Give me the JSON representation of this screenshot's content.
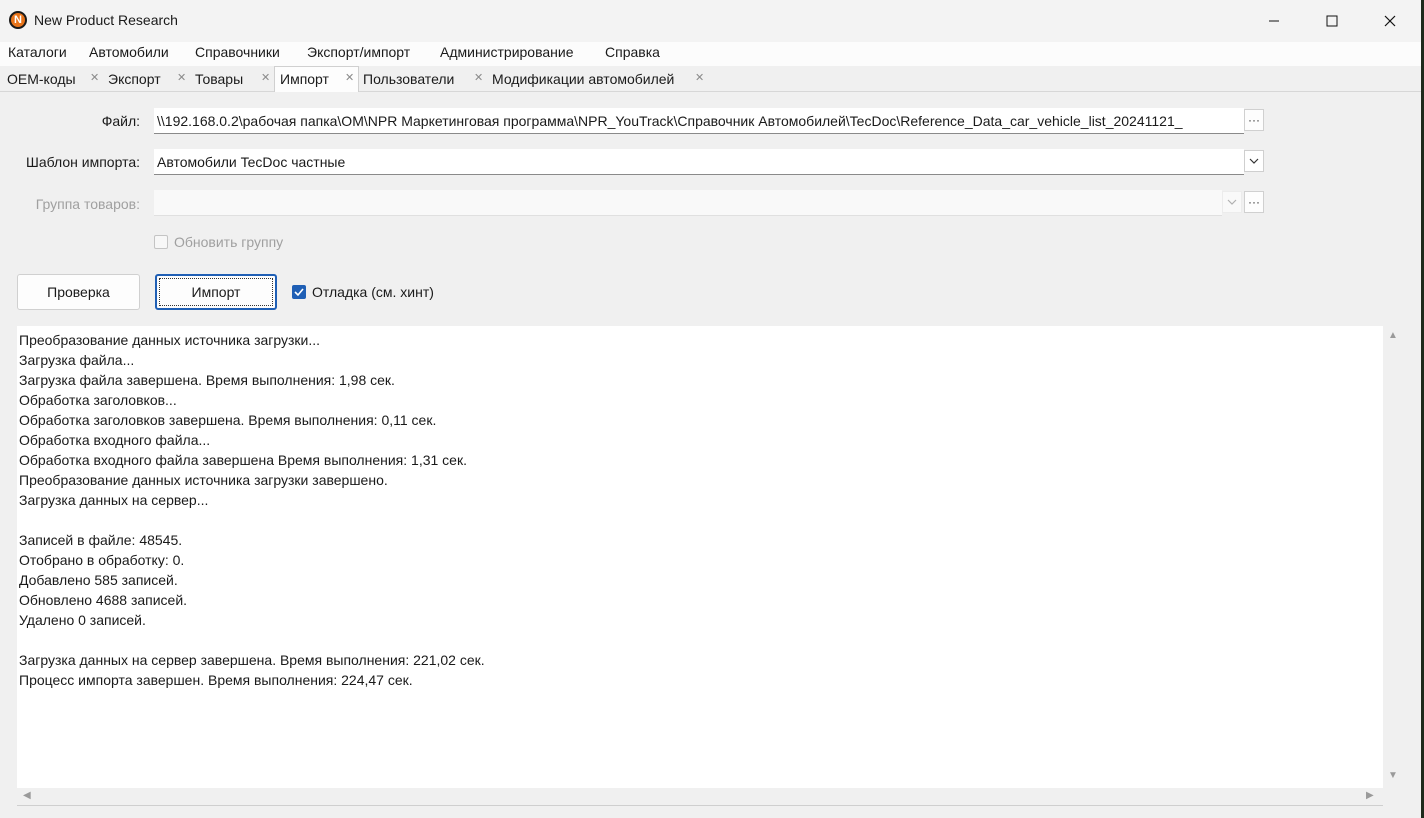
{
  "window": {
    "title": "New Product Research",
    "icon_letter": "N"
  },
  "menu": [
    "Каталоги",
    "Автомобили",
    "Справочники",
    "Экспорт/импорт",
    "Администрирование",
    "Справка"
  ],
  "tabs": [
    {
      "label": "OEM-коды",
      "close": "✕"
    },
    {
      "label": "Экспорт",
      "close": "✕"
    },
    {
      "label": "Товары",
      "close": "✕"
    },
    {
      "label": "Импорт",
      "close": "✕",
      "active": true
    },
    {
      "label": "Пользователи",
      "close": "✕"
    },
    {
      "label": "Модификации автомобилей",
      "close": "✕"
    }
  ],
  "form": {
    "file_label": "Файл:",
    "file_value": "\\\\192.168.0.2\\рабочая папка\\OM\\NPR Маркетинговая программа\\NPR_YouTrack\\Справочник Автомобилей\\TecDoc\\Reference_Data_car_vehicle_list_20241121_",
    "browse": "···",
    "template_label": "Шаблон импорта:",
    "template_value": "Автомобили TecDoc частные",
    "group_label": "Группа товаров:",
    "group_value": "",
    "update_group_label": "Обновить группу",
    "update_group_checked": false
  },
  "actions": {
    "check_label": "Проверка",
    "import_label": "Импорт",
    "debug_label": "Отладка (см. хинт)",
    "debug_checked": true
  },
  "log": [
    "Преобразование данных источника загрузки...",
    "Загрузка файла...",
    "Загрузка файла завершена. Время выполнения: 1,98 сек.",
    "Обработка заголовков...",
    "Обработка заголовков завершена. Время выполнения: 0,11 сек.",
    "Обработка входного файла...",
    "Обработка входного файла завершена Время выполнения: 1,31 сек.",
    "Преобразование данных источника загрузки завершено.",
    "Загрузка данных на сервер...",
    "",
    "Записей в файле: 48545.",
    "Отобрано в обработку: 0.",
    "Добавлено 585 записей.",
    "Обновлено 4688 записей.",
    "Удалено 0 записей.",
    "",
    "Загрузка данных на сервер завершена. Время выполнения: 221,02 сек.",
    "Процесс импорта завершен. Время выполнения: 224,47 сек."
  ]
}
